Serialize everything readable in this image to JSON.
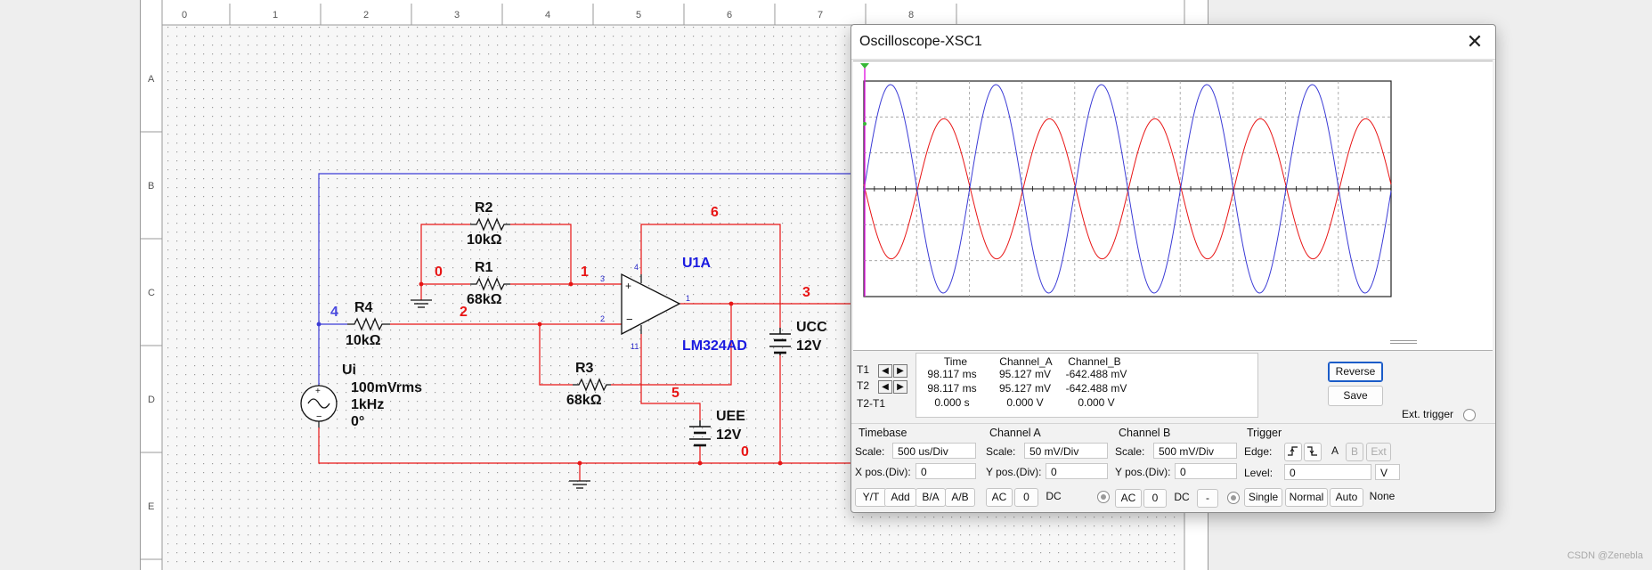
{
  "schematic": {
    "ruler_cols": [
      "0",
      "1",
      "2",
      "3",
      "4",
      "5",
      "6",
      "7",
      "8"
    ],
    "ruler_rows": [
      "A",
      "B",
      "C",
      "D",
      "E"
    ],
    "components": {
      "r2": {
        "name": "R2",
        "value": "10kΩ"
      },
      "r1": {
        "name": "R1",
        "value": "68kΩ"
      },
      "r4": {
        "name": "R4",
        "value": "10kΩ"
      },
      "r3": {
        "name": "R3",
        "value": "68kΩ"
      },
      "opamp": {
        "name": "U1A",
        "part": "LM324AD"
      },
      "ucc": {
        "name": "UCC",
        "value": "12V"
      },
      "uee": {
        "name": "UEE",
        "value": "12V"
      },
      "source": {
        "name": "Ui",
        "amplitude": "100mVrms",
        "freq": "1kHz",
        "phase": "0°"
      }
    },
    "nets": {
      "n0a": "0",
      "n0b": "0",
      "n1": "1",
      "n2": "2",
      "n3": "3",
      "n4": "4",
      "n5": "5",
      "n6": "6"
    },
    "pins": {
      "p3": "3",
      "p2": "2",
      "p1": "1",
      "p4": "4",
      "p11": "11"
    },
    "colors": {
      "wire_red": "#e81414",
      "wire_blue": "#3b3bd6",
      "net_label_red": "#e81414",
      "net_label_blue": "#4a4ae0"
    }
  },
  "oscilloscope": {
    "title": "Oscilloscope-XSC1",
    "close_icon": "✕",
    "channel_a_color": "#e81414",
    "channel_b_color": "#3b3bd6",
    "measurements": {
      "headers": [
        "Time",
        "Channel_A",
        "Channel_B"
      ],
      "rows": [
        {
          "label": "T1",
          "time": "98.117 ms",
          "a": "95.127 mV",
          "b": "-642.488 mV"
        },
        {
          "label": "T2",
          "time": "98.117 ms",
          "a": "95.127 mV",
          "b": "-642.488 mV"
        },
        {
          "label": "T2-T1",
          "time": "0.000 s",
          "a": "0.000 V",
          "b": "0.000 V"
        }
      ]
    },
    "reverse_label": "Reverse",
    "save_label": "Save",
    "ext_trigger_label": "Ext. trigger",
    "timebase": {
      "title": "Timebase",
      "scale_label": "Scale:",
      "scale": "500 us/Div",
      "xpos_label": "X pos.(Div):",
      "xpos": "0",
      "buttons": [
        "Y/T",
        "Add",
        "B/A",
        "A/B"
      ]
    },
    "channel_a": {
      "title": "Channel A",
      "scale_label": "Scale:",
      "scale": "50 mV/Div",
      "ypos_label": "Y pos.(Div):",
      "ypos": "0",
      "ac": "AC",
      "zero": "0",
      "dc": "DC"
    },
    "channel_b": {
      "title": "Channel B",
      "scale_label": "Scale:",
      "scale": "500 mV/Div",
      "ypos_label": "Y pos.(Div):",
      "ypos": "0",
      "ac": "AC",
      "zero": "0",
      "dc": "DC",
      "minus": "-"
    },
    "trigger": {
      "title": "Trigger",
      "edge_label": "Edge:",
      "level_label": "Level:",
      "level": "0",
      "level_unit": "V",
      "sources": [
        "A",
        "B",
        "Ext"
      ],
      "modes": [
        "Single",
        "Normal",
        "Auto",
        "None"
      ]
    },
    "waveforms": {
      "channel_a_cycles_visible": 5.0,
      "channel_b_cycles_visible": 5.0,
      "channel_a_amplitude_div": 3.9,
      "channel_b_amplitude_div": 5.8
    }
  },
  "watermark": "CSDN @Zenebla"
}
